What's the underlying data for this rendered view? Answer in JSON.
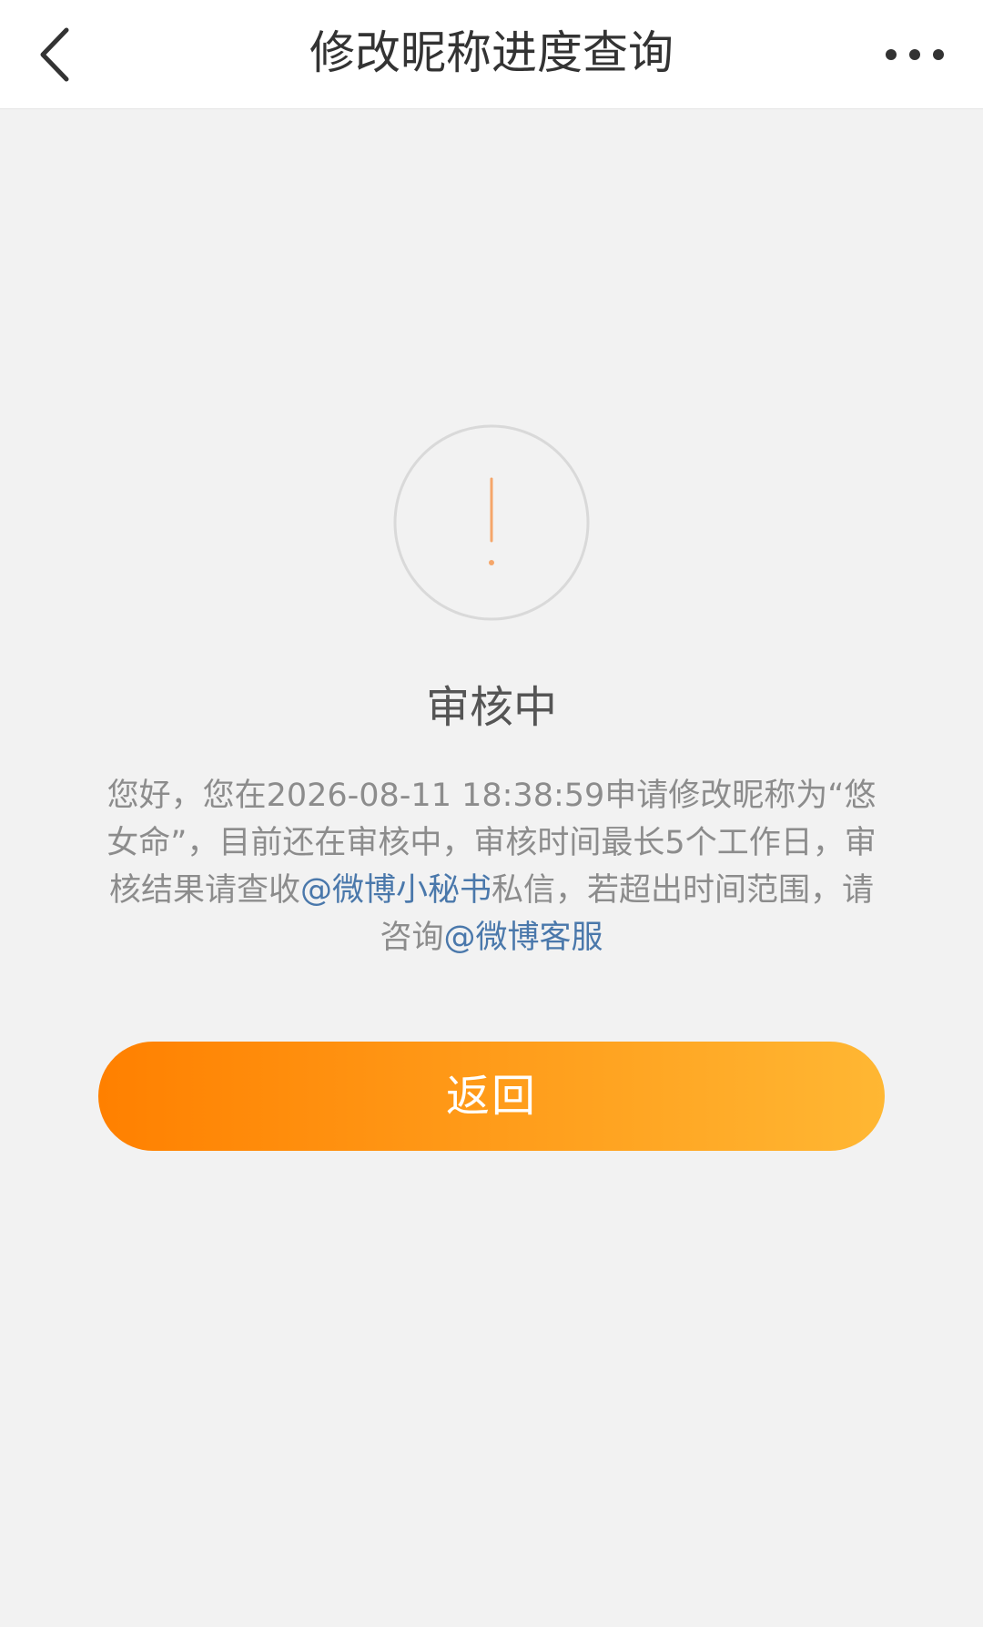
{
  "header": {
    "title": "修改昵称进度查询",
    "back_icon": "chevron-left-icon",
    "more_icon": "more-dots-icon"
  },
  "status": {
    "icon": "exclamation-circle-icon",
    "title": "审核中"
  },
  "message": {
    "part1": "您好，您在2026-08-11 18:38:59申请修改昵称为“悠女命”，目前还在审核中，审核时间最长5个工作日，审核结果请查收",
    "link1": "@微博小秘书",
    "part2": "私信，若超出时间范围，请咨询",
    "link2": "@微博客服"
  },
  "actions": {
    "return_label": "返回"
  },
  "colors": {
    "accent_start": "#ff8000",
    "accent_end": "#ffb733",
    "link": "#4a78ab",
    "icon_mark": "#f5a66a"
  }
}
